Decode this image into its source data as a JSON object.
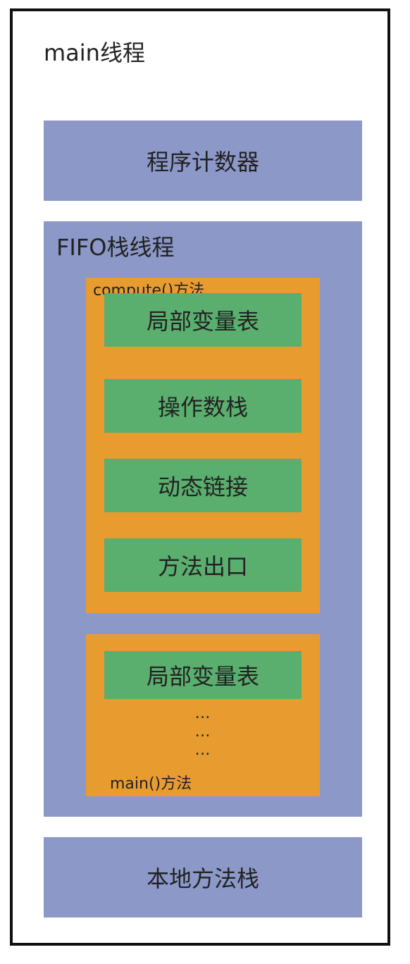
{
  "diagram": {
    "thread_title": "main线程",
    "program_counter": "程序计数器",
    "stack": {
      "title": "FIFO栈线程",
      "frames": [
        {
          "label": "compute()方法",
          "items": [
            "局部变量表",
            "操作数栈",
            "动态链接",
            "方法出口"
          ]
        },
        {
          "label": "main()方法",
          "items": [
            "局部变量表"
          ],
          "ellipsis": [
            "…",
            "…",
            "…"
          ]
        }
      ]
    },
    "native_stack": "本地方法栈"
  },
  "colors": {
    "thread_block": "#8c98c8",
    "stack_frame": "#e89c30",
    "frame_item": "#5aae6e",
    "border": "#111111"
  }
}
